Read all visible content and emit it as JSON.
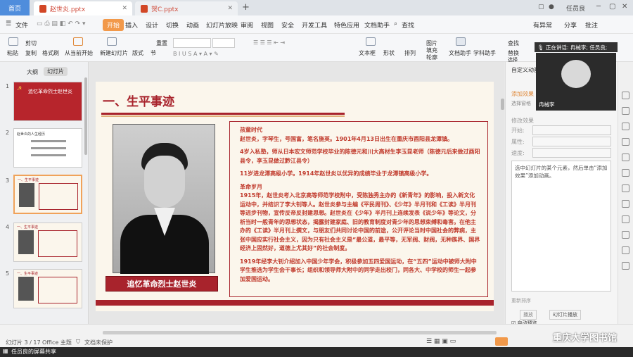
{
  "tabs": {
    "home": "首页",
    "doc1": "赵世炎.pptx",
    "doc2": "贺C.pptx",
    "user": "任员良"
  },
  "menu": {
    "file": "文件",
    "start": "开始",
    "insert": "插入",
    "design": "设计",
    "switch": "切换",
    "animation": "动画",
    "slideshow": "幻灯片放映",
    "review": "审阅",
    "view": "视图",
    "security": "安全",
    "devtools": "开发工具",
    "features": "特色应用",
    "docassist": "文档助手",
    "search": "查找",
    "unsaved": "有异常",
    "share": "分享",
    "comment": "批注"
  },
  "toolbar": {
    "paste": "粘贴",
    "cut": "剪切",
    "copy": "复制",
    "format_painter": "格式刷",
    "from_start": "从当前开始",
    "new_slide": "新建幻灯片",
    "layout": "版式",
    "section": "节",
    "reset": "重置",
    "textbox": "文本框",
    "shape": "形状",
    "arrange": "排列",
    "picture": "图片",
    "fill": "填充",
    "outline": "轮廓",
    "doc_assist": "文档助手",
    "subject_assist": "学科助手",
    "find": "查找",
    "replace": "替换",
    "select": "选择"
  },
  "left_panel": {
    "outline_tab": "大纲",
    "slides_tab": "幻灯片",
    "slide_numbers": [
      "1",
      "2",
      "3",
      "4",
      "5"
    ],
    "thumb1_title": "追忆革命烈士赵世炎",
    "thumb2_title": "赵世炎的人生经历",
    "thumb_heading": "一、生平事迹"
  },
  "slide": {
    "heading": "一、生平事迹",
    "caption": "追忆革命烈士赵世炎",
    "sections": [
      {
        "title": "孩童时代",
        "paragraphs": [
          "赵世炎，字琴生，号国富，笔名施英。1901年4月13日出生在重庆市酉阳县龙潭镇。",
          "4岁入私塾，师从日本宏文师范学校毕业的陈德元和川大高材生李玉昆老师（陈德元后来做过酉阳县令，李玉昆做过黔江县令）",
          "11岁进龙潭高级小学。1914年赵世炎以优异的成绩毕业于龙潭镇高级小学。"
        ]
      },
      {
        "title": "革命岁月",
        "paragraphs": [
          "1915年，赵世炎考入北京高等师范学校附中，受陈独秀主办的《新青年》的影响，投入新文化运动中，并结识了李大钊等人。赵世炎参与主编《平民周刊》、《少年》半月刊和《工读》半月刊等进步刊物，宣传反帝反封建思想。赵世炎在《少年》半月刊上连续发表《说少年》等论文，分析当时一般青年的思想状态，揭露封建家庭、旧的教育制度对青少年的思想束缚和毒害。在他主办的《工读》半月刊上撰文，与朋友们共同讨论中国的前途，公开评论当时中国社会的弊病，主张中国应实行社会主义，因为只有社会主义是“最公道，最平等，无军阀、财阀，无种族界、国界经济上固然好，道德上尤其好”的社会制度。",
          "1919年经李大钊介绍加入中国少年学会，积极参加五四爱国运动，在“五四”运动中被师大附中学生推选为学生会干事长；组织和领导师大附中的同学走出校门，同各大、中学校的师生一起参加爱国运动。"
        ]
      }
    ]
  },
  "right_panel": {
    "title": "自定义动画",
    "select_label": "选择窗格",
    "add_effect": "添加效果",
    "modify_label": "修改效果",
    "start_label": "开始:",
    "property_label": "属性:",
    "speed_label": "速度:",
    "hint": "选中幻灯片的某个元素，然后单击“添加效果”添加动画。",
    "reorder_label": "重新排序",
    "play_button": "播放",
    "slideshow_button": "幻灯片播放",
    "autopreview_label": "自动预览"
  },
  "video_call": {
    "speaking": "正在讲话: 冉械李; 任员良;",
    "name": "冉械李"
  },
  "statusbar": {
    "slide_count": "幻灯片 3 / 17",
    "theme": "Office 主题",
    "protect": "文档未保护",
    "watermark": "重庆大学图书馆"
  },
  "share_bar": "任员良的屏幕共享",
  "colors": {
    "accent_orange": "#f2994a",
    "slide_red": "#a8232c",
    "text_red": "#c0392b",
    "section_title_red": "#c0392b"
  }
}
